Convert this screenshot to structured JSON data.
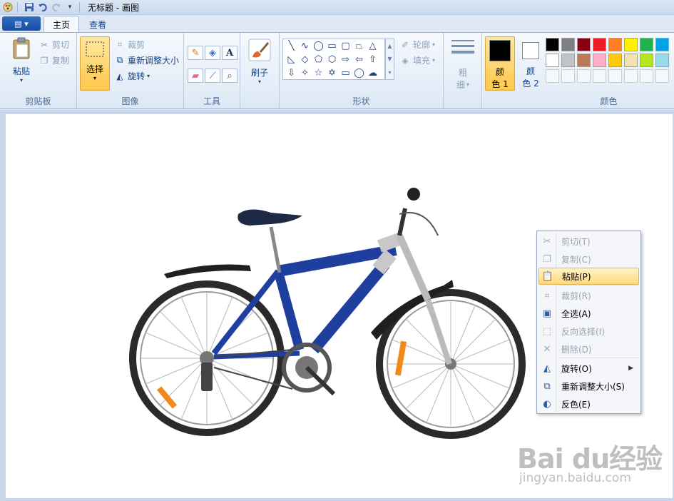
{
  "window": {
    "title": "无标题 - 画图"
  },
  "tabs": [
    {
      "label": "主页"
    },
    {
      "label": "查看"
    }
  ],
  "clipboard": {
    "group_label": "剪贴板",
    "paste": "粘贴",
    "cut": "剪切",
    "copy": "复制"
  },
  "image": {
    "group_label": "图像",
    "select": "选择",
    "crop": "裁剪",
    "resize": "重新调整大小",
    "rotate": "旋转"
  },
  "tools": {
    "group_label": "工具"
  },
  "brushes": {
    "label": "刷子"
  },
  "shapes": {
    "group_label": "形状",
    "outline": "轮廓",
    "fill": "填充"
  },
  "size": {
    "label_1": "粗",
    "label_2": "细"
  },
  "colors": {
    "group_label": "颜色",
    "color1": {
      "label_1": "颜",
      "label_2": "色 1",
      "value": "#000000"
    },
    "color2": {
      "label_1": "颜",
      "label_2": "色 2",
      "value": "#ffffff"
    },
    "palette_row1": [
      "#000000",
      "#7f7f7f",
      "#880015",
      "#ed1c24",
      "#ff7f27",
      "#fff200",
      "#22b14c",
      "#00a2e8"
    ],
    "palette_row2": [
      "#ffffff",
      "#c3c3c3",
      "#b97a57",
      "#ffaec9",
      "#ffc90e",
      "#efe4b0",
      "#b5e61d",
      "#99d9ea"
    ]
  },
  "context_menu": {
    "items": [
      {
        "label": "剪切(T)",
        "icon": "scissors-icon",
        "enabled": false
      },
      {
        "label": "复制(C)",
        "icon": "copy-icon",
        "enabled": false
      },
      {
        "label": "粘贴(P)",
        "icon": "paste-icon",
        "enabled": true,
        "highlighted": true
      },
      {
        "label": "裁剪(R)",
        "icon": "crop-icon",
        "enabled": false
      },
      {
        "label": "全选(A)",
        "icon": "select-all-icon",
        "enabled": true
      },
      {
        "label": "反向选择(I)",
        "icon": "invert-selection-icon",
        "enabled": false
      },
      {
        "label": "删除(D)",
        "icon": "delete-icon",
        "enabled": false
      },
      {
        "label": "旋转(O)",
        "icon": "rotate-icon",
        "enabled": true,
        "submenu": true
      },
      {
        "label": "重新调整大小(S)",
        "icon": "resize-icon",
        "enabled": true
      },
      {
        "label": "反色(E)",
        "icon": "invert-color-icon",
        "enabled": true
      }
    ]
  },
  "watermark": {
    "brand": "Bai du经验",
    "url": "jingyan.baidu.com"
  }
}
